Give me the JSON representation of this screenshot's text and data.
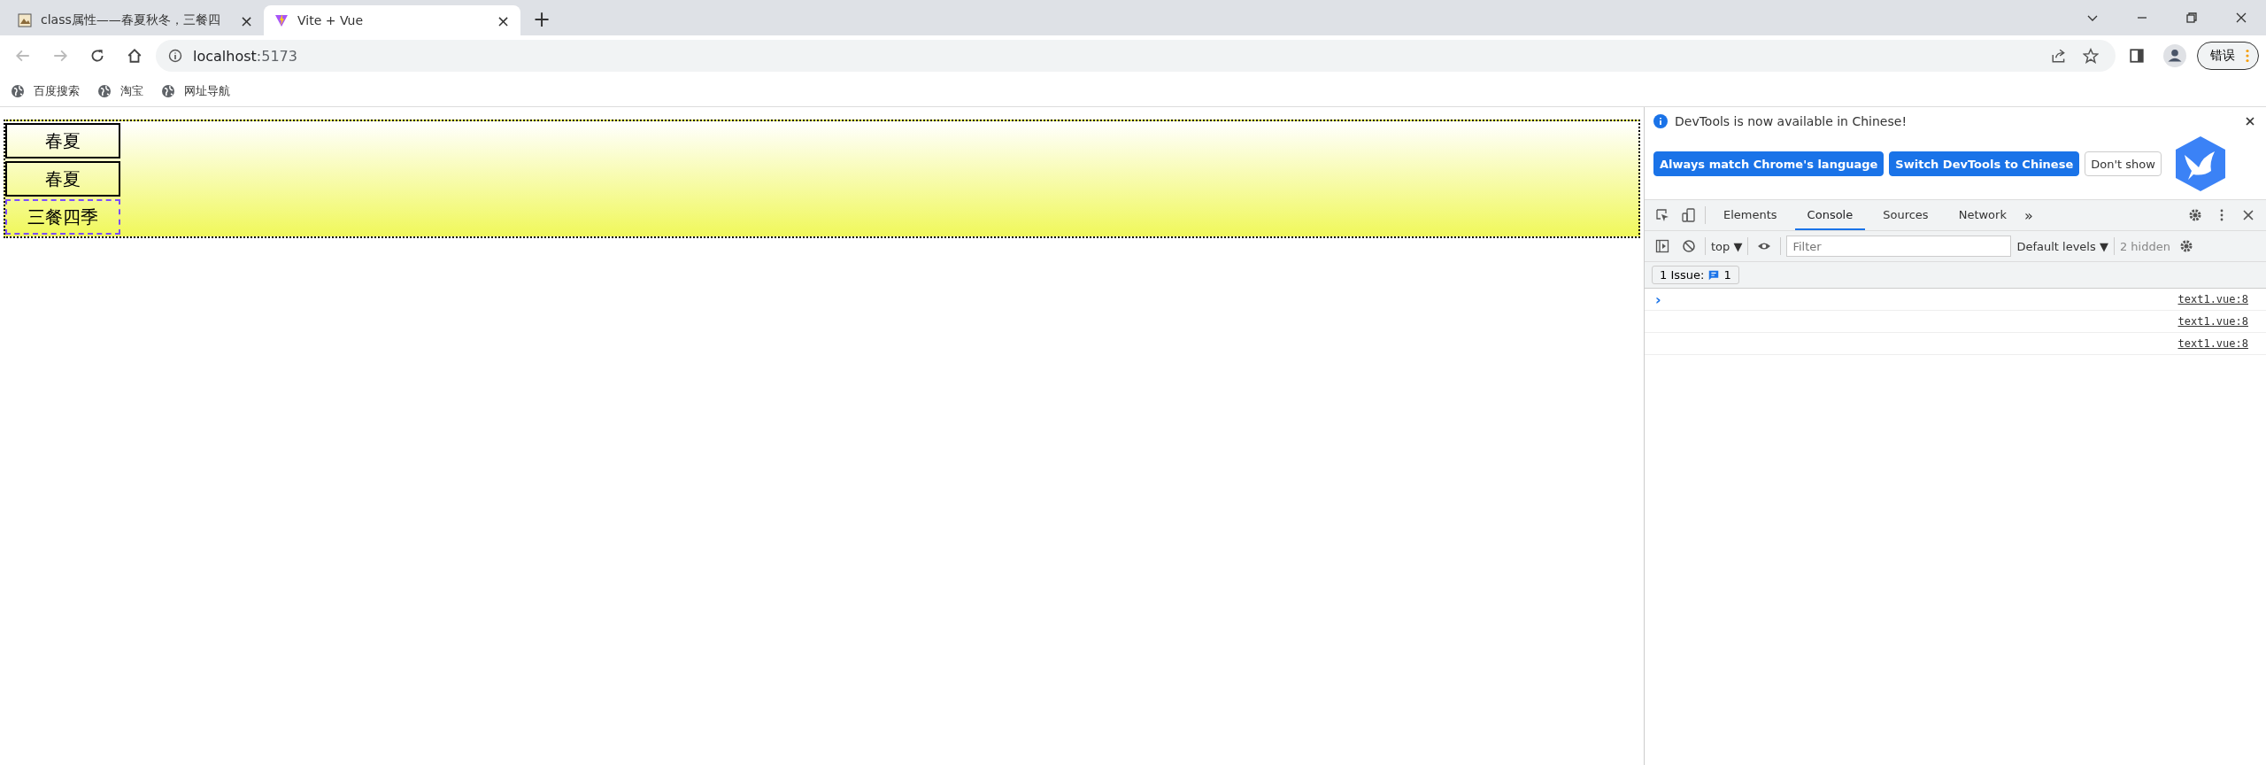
{
  "tabs": [
    {
      "title": "class属性——春夏秋冬，三餐四",
      "selected": false,
      "close": "×"
    },
    {
      "title": "Vite + Vue",
      "selected": true,
      "close": "×"
    }
  ],
  "new_tab": "+",
  "address": {
    "host": "localhost",
    "port": ":5173"
  },
  "profile_button": "错误",
  "bookmarks": [
    "百度搜索",
    "淘宝",
    "网址导航"
  ],
  "page": {
    "items": [
      {
        "label": "春夏",
        "kind": "solid"
      },
      {
        "label": "春夏",
        "kind": "solid"
      },
      {
        "label": "三餐四季",
        "kind": "dashed"
      }
    ]
  },
  "devtools": {
    "notice": "DevTools is now available in Chinese!",
    "notice_buttons": [
      {
        "label": "Always match Chrome's language",
        "kind": "primary"
      },
      {
        "label": "Switch DevTools to Chinese",
        "kind": "primary"
      },
      {
        "label": "Don't show",
        "kind": "plain"
      }
    ],
    "tabs": [
      {
        "label": "Elements",
        "selected": false
      },
      {
        "label": "Console",
        "selected": true
      },
      {
        "label": "Sources",
        "selected": false
      },
      {
        "label": "Network",
        "selected": false
      }
    ],
    "more_tabs": "»",
    "context": "top ▼",
    "filter": {
      "placeholder": "Filter"
    },
    "levels": "Default levels ▼",
    "hidden": "2 hidden",
    "issues": {
      "label": "1 Issue:",
      "count": "1"
    },
    "prompt": "›",
    "log_rows": [
      {
        "source": "text1.vue:8"
      },
      {
        "source": "text1.vue:8"
      },
      {
        "source": "text1.vue:8"
      }
    ]
  }
}
